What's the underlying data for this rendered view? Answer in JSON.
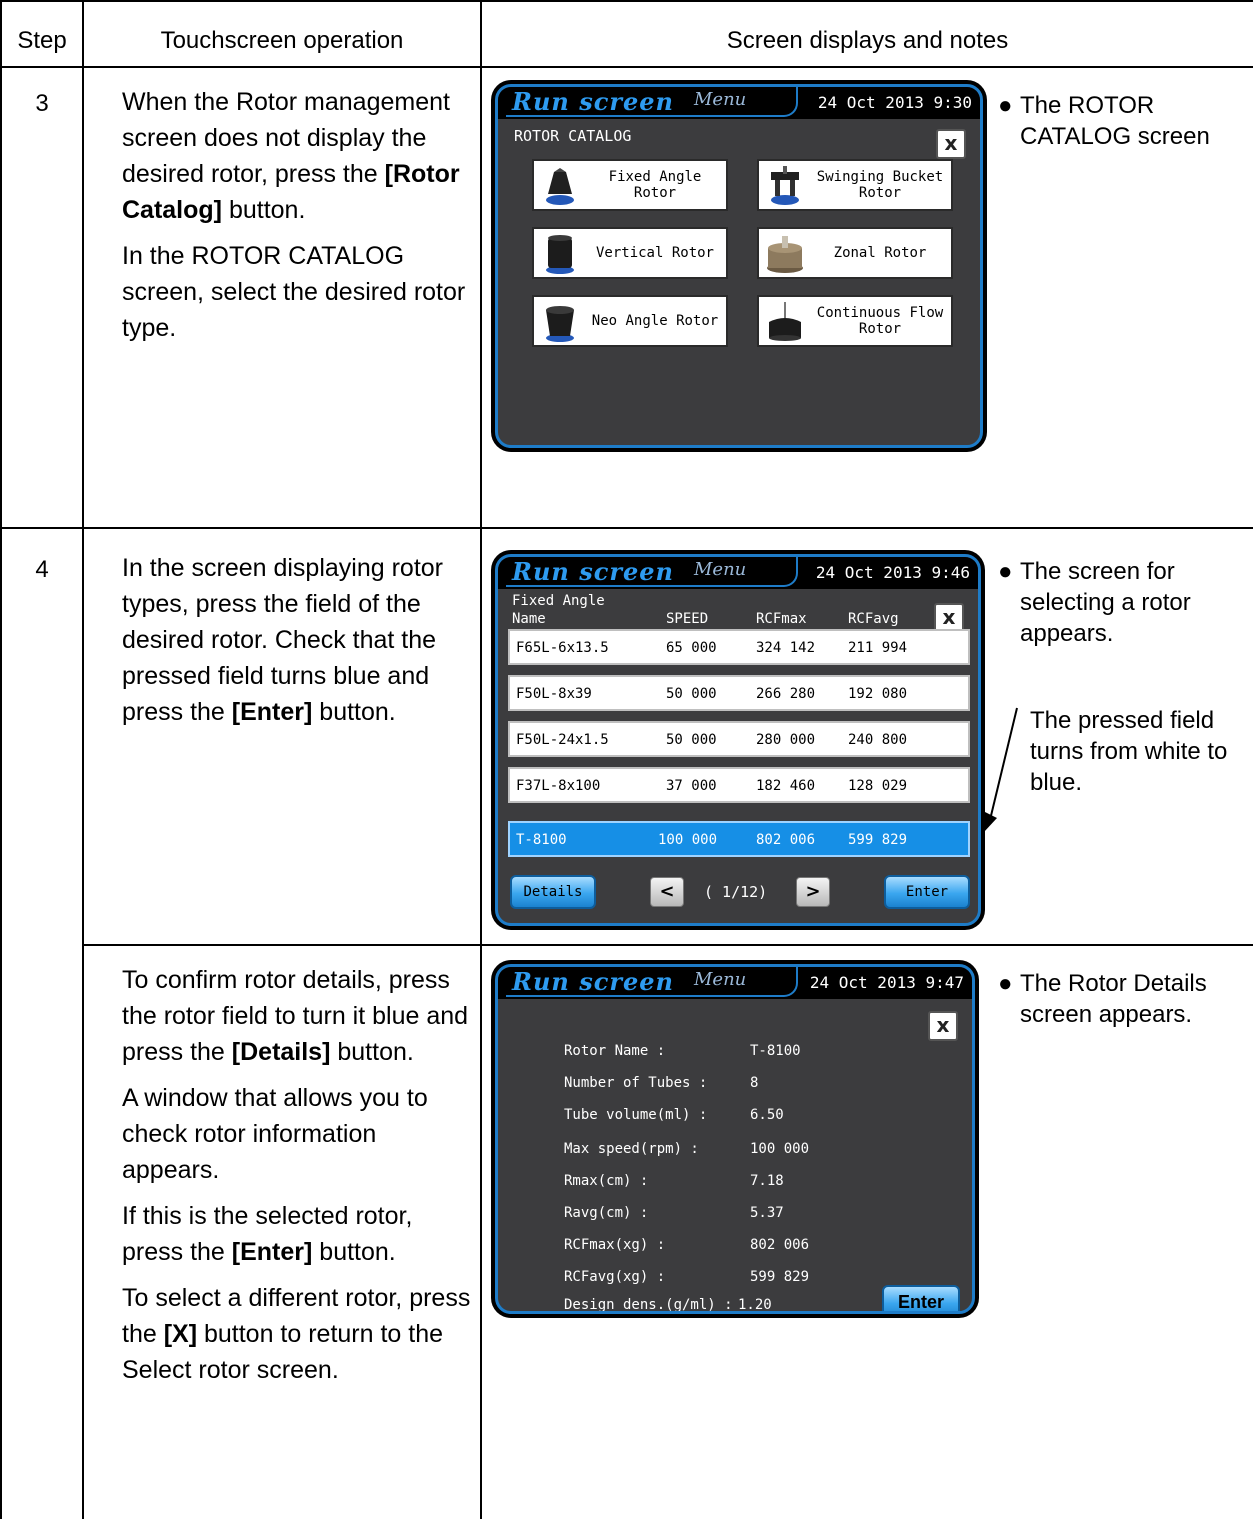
{
  "headers": {
    "step": "Step",
    "operation": "Touchscreen operation",
    "notes": "Screen displays and notes"
  },
  "step3": {
    "number": "3",
    "para1_pre": "When the Rotor management screen does not display the desired rotor, press the ",
    "para1_bold": "[Rotor Catalog]",
    "para1_post": " button.",
    "para2": "In the ROTOR CATALOG screen, select the desired rotor type.",
    "note": "The ROTOR CATALOG screen",
    "screen": {
      "run_logo": "Run screen",
      "menu_logo": "Menu",
      "datetime": "24 Oct 2013  9:30",
      "close": "x",
      "title": "ROTOR CATALOG",
      "buttons": [
        {
          "label": "Fixed Angle\nRotor",
          "icon": "fixed-angle-rotor-icon"
        },
        {
          "label": "Swinging Bucket\nRotor",
          "icon": "swinging-bucket-rotor-icon"
        },
        {
          "label": "Vertical Rotor",
          "icon": "vertical-rotor-icon"
        },
        {
          "label": "Zonal Rotor",
          "icon": "zonal-rotor-icon"
        },
        {
          "label": "Neo Angle Rotor",
          "icon": "neo-angle-rotor-icon"
        },
        {
          "label": "Continuous Flow\nRotor",
          "icon": "continuous-flow-rotor-icon"
        }
      ]
    }
  },
  "step4": {
    "number": "4",
    "para1_pre": "In the screen displaying rotor types, press the field of the desired rotor. Check that the pressed field turns blue and press the ",
    "para1_bold": "[Enter]",
    "para1_post": " button.",
    "note1": "The screen for selecting a rotor appears.",
    "callout": "The pressed field turns from white to blue.",
    "screen": {
      "run_logo": "Run screen",
      "menu_logo": "Menu",
      "datetime": "24 Oct 2013  9:46",
      "close": "x",
      "category": "Fixed Angle",
      "columns": [
        "Name",
        "SPEED",
        "RCFmax",
        "RCFavg"
      ],
      "rows": [
        {
          "name": "F65L-6x13.5",
          "speed": "65 000",
          "rcfmax": "324 142",
          "rcfavg": "211 994",
          "selected": false
        },
        {
          "name": "F50L-8x39",
          "speed": "50 000",
          "rcfmax": "266 280",
          "rcfavg": "192 080",
          "selected": false
        },
        {
          "name": "F50L-24x1.5",
          "speed": "50 000",
          "rcfmax": "280 000",
          "rcfavg": "240 800",
          "selected": false
        },
        {
          "name": "F37L-8x100",
          "speed": "37 000",
          "rcfmax": "182 460",
          "rcfavg": "128 029",
          "selected": false
        },
        {
          "name": "T-8100",
          "speed": "100 000",
          "rcfmax": "802 006",
          "rcfavg": "599 829",
          "selected": true
        }
      ],
      "details_btn": "Details",
      "prev_btn": "<",
      "page": "( 1/12)",
      "next_btn": ">",
      "enter_btn": "Enter"
    }
  },
  "step4b": {
    "para1_pre": "To confirm rotor details, press the rotor field to turn it blue and press the ",
    "para1_bold": "[Details]",
    "para1_post": " button.",
    "para2": "A window that allows you to check rotor information appears.",
    "para3_pre": "If this is the selected rotor, press the ",
    "para3_bold": "[Enter]",
    "para3_post": " button.",
    "para4_pre": "To select a different rotor, press the ",
    "para4_bold": "[X]",
    "para4_post": " button to return to the Select rotor screen.",
    "note": "The Rotor Details screen appears.",
    "screen": {
      "run_logo": "Run screen",
      "menu_logo": "Menu",
      "datetime": "24 Oct 2013  9:47",
      "close": "x",
      "details": [
        {
          "label": "Rotor Name :",
          "value": "T-8100"
        },
        {
          "label": "Number of Tubes :",
          "value": "8"
        },
        {
          "label": "Tube volume(ml) :",
          "value": "6.50"
        },
        {
          "label": "Max speed(rpm) :",
          "value": "100 000"
        },
        {
          "label": "Rmax(cm) :",
          "value": "7.18"
        },
        {
          "label": "Ravg(cm) :",
          "value": "5.37"
        },
        {
          "label": "RCFmax(xg) :",
          "value": "802 006"
        },
        {
          "label": "RCFavg(xg) :",
          "value": "599 829"
        },
        {
          "label": "Design dens.(g/ml) :",
          "value": "1.20"
        }
      ],
      "enter_btn": "Enter"
    }
  },
  "colors": {
    "screen_bg": "#3c3c3e",
    "accent_blue": "#1e7cc8",
    "selected_row": "#168fe6"
  }
}
